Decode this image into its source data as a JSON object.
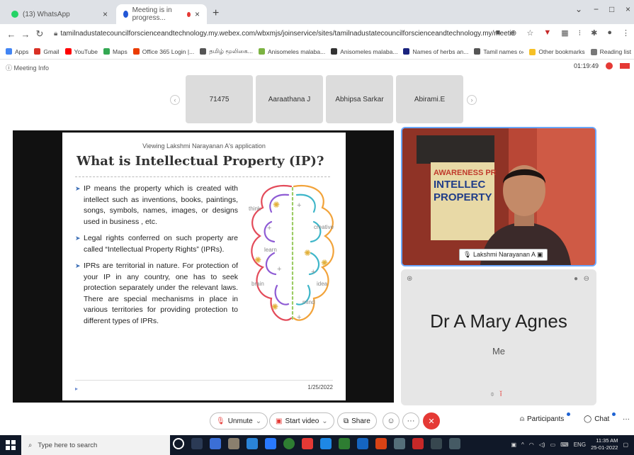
{
  "browser": {
    "tabs": [
      {
        "title": "(13) WhatsApp",
        "icon": "whatsapp-icon",
        "color": "#25d366"
      },
      {
        "title": "Meeting is in progress...",
        "icon": "webex-icon",
        "color": "#2257d6"
      }
    ],
    "new_tab": "+",
    "url": "tamilnadustatecouncilforscienceandtechnology.my.webex.com/wbxmjs/joinservice/sites/tamilnadustatecouncilforscienceandtechnology.my/meeting/download/e8196136e5c1...",
    "bookmarks": [
      {
        "label": "Apps",
        "color": "#4285f4"
      },
      {
        "label": "Gmail",
        "color": "#d93025"
      },
      {
        "label": "YouTube",
        "color": "#ff0000"
      },
      {
        "label": "Maps",
        "color": "#34a853"
      },
      {
        "label": "Office 365 Login |...",
        "color": "#eb3c00"
      },
      {
        "label": "தமிழ் மூலிகை...",
        "color": "#555555"
      },
      {
        "label": "Anisomeles malaba...",
        "color": "#7cb342"
      },
      {
        "label": "Anisomeles malaba...",
        "color": "#333333"
      },
      {
        "label": "Names of herbs an...",
        "color": "#1a237e"
      },
      {
        "label": "Tamil names of her...",
        "color": "#555555"
      }
    ],
    "other_bookmarks": "Other bookmarks",
    "reading_list": "Reading list",
    "bm_more": "»"
  },
  "meeting": {
    "info_label": "Meeting Info",
    "timer": "01:19:49",
    "participants_strip": [
      "71475",
      "Aaraathana J",
      "Abhipsa Sarkar",
      "Abirami.E"
    ],
    "strip_prev": "‹",
    "strip_next": "›"
  },
  "slide": {
    "viewing_label": "Viewing Lakshmi Narayanan A's application",
    "title": "What is Intellectual Property (IP)?",
    "bullets": [
      "IP means the property which is created with intellect such as inventions, books, paintings, songs, symbols, names, images, or designs used in business , etc.",
      "Legal rights conferred on such property are called “Intellectual Property Rights” (IPRs).",
      "IPRs are territorial in nature. For protection of your IP in any country, one has to seek protection separately under the relevant laws. There are special mechanisms in place in various territories for providing protection to different types of IPRs."
    ],
    "brain_words": [
      "think",
      "creative",
      "learn",
      "brain",
      "idea",
      "mind"
    ],
    "date": "1/25/2022",
    "nav_marker": "▸"
  },
  "video": {
    "presenter_name": "Lakshmi Narayanan A",
    "backdrop_text": [
      "AWARENESS PR",
      "INTELLEC",
      "PROPERTY"
    ]
  },
  "me": {
    "name": "Dr A Mary Agnes",
    "sub": "Me"
  },
  "controls": {
    "unmute": "Unmute",
    "start_video": "Start video",
    "share": "Share",
    "more": "···",
    "end": "✕",
    "participants": "Participants",
    "chat": "Chat",
    "overflow": "···"
  },
  "taskbar": {
    "search_placeholder": "Type here to search",
    "lang": "ENG",
    "time": "11:35 AM",
    "date": "25-01-2022"
  }
}
